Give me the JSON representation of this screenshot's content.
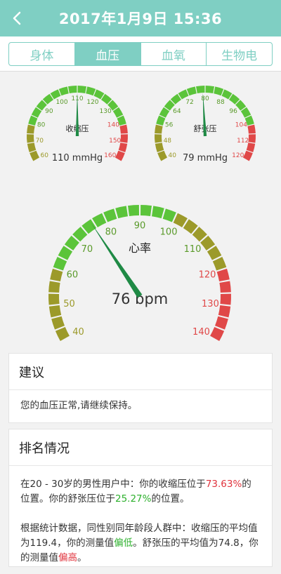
{
  "header": {
    "title": "2017年1月9日 15:36"
  },
  "tabs": [
    {
      "label": "身体",
      "active": false
    },
    {
      "label": "血压",
      "active": true
    },
    {
      "label": "血氧",
      "active": false
    },
    {
      "label": "生物电",
      "active": false
    }
  ],
  "gauges": {
    "systolic": {
      "name": "收缩压",
      "readout": "110 mmHg",
      "value": 110,
      "ticks": [
        "60",
        "70",
        "80",
        "90",
        "100",
        "110",
        "120",
        "130",
        "140",
        "150",
        "160"
      ]
    },
    "diastolic": {
      "name": "舒张压",
      "readout": "79 mmHg",
      "value": 79,
      "ticks": [
        "40",
        "48",
        "56",
        "64",
        "72",
        "80",
        "88",
        "96",
        "104",
        "112",
        "120"
      ]
    },
    "heart_rate": {
      "name": "心率",
      "readout": "76 bpm",
      "value": 76,
      "ticks": [
        "40",
        "50",
        "60",
        "70",
        "80",
        "90",
        "100",
        "110",
        "120",
        "130",
        "140"
      ]
    }
  },
  "advice": {
    "title": "建议",
    "text": "您的血压正常,请继续保持。"
  },
  "ranking": {
    "title": "排名情况",
    "p1_a": "在20 - 30岁的男性用户中：你的收缩压位于",
    "p1_b": "73.63%",
    "p1_c": "的位置。你的舒张压位于",
    "p1_d": "25.27%",
    "p1_e": "的位置。",
    "p2_a": "根据统计数据，同性别同年龄段人群中：收缩压的平均值为119.4，你的测量值",
    "p2_b": "偏低",
    "p2_c": "。舒张压的平均值为74.8，你的测量值",
    "p2_d": "偏高",
    "p2_e": "。"
  },
  "colors": {
    "accent": "#7fcfc3",
    "gauge_olive": "#9c9a2a",
    "gauge_green": "#5bc43a",
    "gauge_red": "#e04848",
    "highlight_red": "#e0323c",
    "highlight_green": "#2db02d"
  }
}
